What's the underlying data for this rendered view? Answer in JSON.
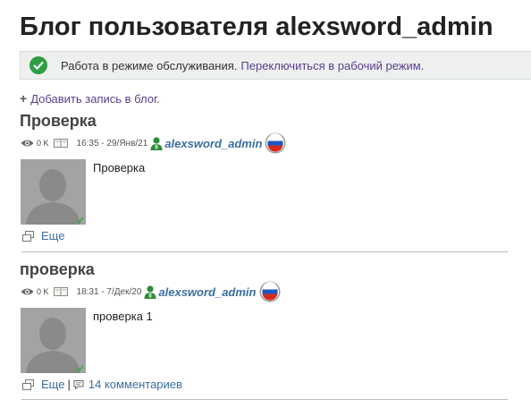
{
  "page": {
    "title": "Блог пользователя alexsword_admin"
  },
  "notice": {
    "message": "Работа в режиме обслуживания.",
    "link": "Переключиться в рабочий режим.",
    "icon": "check-circle-icon",
    "icon_color": "#2e9e44"
  },
  "add_entry": {
    "label": "Добавить запись в блог."
  },
  "posts": [
    {
      "title": "Проверка",
      "views": "0 K",
      "date": "16:35 - 29/Янв/21",
      "author": "alexsword_admin",
      "body": "Проверка",
      "more_label": "Еще"
    },
    {
      "title": "проверка",
      "views": "0 K",
      "date": "18:31 - 7/Дек/20",
      "author": "alexsword_admin",
      "body": "проверка 1",
      "more_label": "Еще",
      "comments_label": "14 комментариев"
    }
  ],
  "colors": {
    "link": "#3a6ea5",
    "action_link": "#5a3f8f",
    "user_icon": "#2e8b3a"
  }
}
